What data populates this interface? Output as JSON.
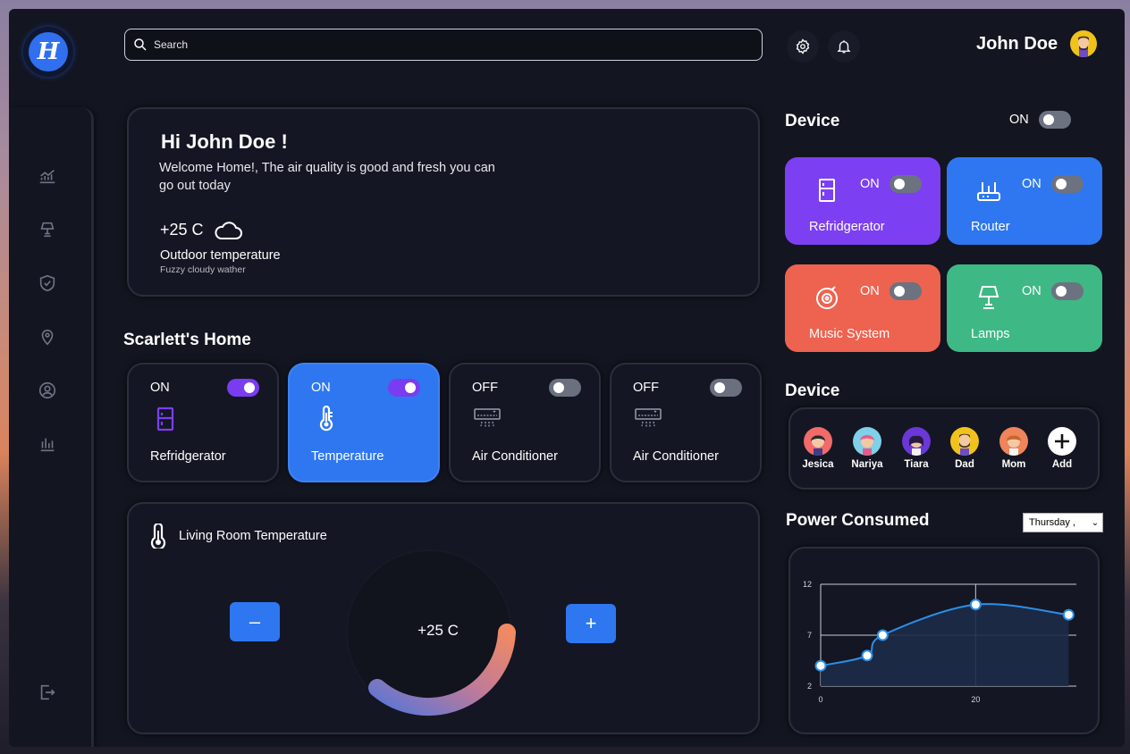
{
  "logo": {
    "letter": "H"
  },
  "search": {
    "placeholder": "Search"
  },
  "user": {
    "name": "John Doe"
  },
  "greeting": {
    "title": "Hi John Doe !",
    "message": "Welcome Home!, The air quality is good and fresh you can go out today",
    "temperature": "+25 C",
    "label": "Outdoor temperature",
    "sublabel": "Fuzzy cloudy wather"
  },
  "home": {
    "title": "Scarlett's Home",
    "rooms": [
      {
        "state": "ON",
        "name": "Refridgerator",
        "on": true
      },
      {
        "state": "ON",
        "name": "Temperature",
        "on": true
      },
      {
        "state": "OFF",
        "name": "Air Conditioner",
        "on": false
      },
      {
        "state": "OFF",
        "name": "Air Conditioner",
        "on": false
      }
    ]
  },
  "living_room": {
    "title": "Living Room Temperature",
    "value": "+25 C",
    "minus_label": "–",
    "plus_label": "+"
  },
  "devices": {
    "title": "Device",
    "master_state": "ON",
    "items": [
      {
        "name": "Refridgerator",
        "state": "ON",
        "color": "#7c3ff2"
      },
      {
        "name": "Router",
        "state": "ON",
        "color": "#2e77f0"
      },
      {
        "name": "Music System",
        "state": "ON",
        "color": "#ee6250"
      },
      {
        "name": "Lamps",
        "state": "ON",
        "color": "#3eb884"
      }
    ]
  },
  "members": {
    "title": "Device",
    "items": [
      {
        "name": "Jesica"
      },
      {
        "name": "Nariya"
      },
      {
        "name": "Tiara"
      },
      {
        "name": "Dad"
      },
      {
        "name": "Mom"
      },
      {
        "name": "Add"
      }
    ]
  },
  "power": {
    "title": "Power Consumed",
    "day": "Thursday ,"
  },
  "chart_data": {
    "type": "area",
    "title": "",
    "xlabel": "",
    "ylabel": "",
    "x": [
      0,
      6,
      8,
      20,
      32
    ],
    "y": [
      4,
      5,
      7,
      10,
      9
    ],
    "xlim": [
      0,
      33
    ],
    "ylim": [
      2,
      12
    ],
    "xticks": [
      0,
      20
    ],
    "yticks": [
      2,
      7,
      12
    ],
    "xtick_labels": [
      "0",
      "20"
    ],
    "ytick_labels": [
      "2",
      "7",
      "12"
    ],
    "grid": true,
    "color": "#2b8fe8"
  }
}
